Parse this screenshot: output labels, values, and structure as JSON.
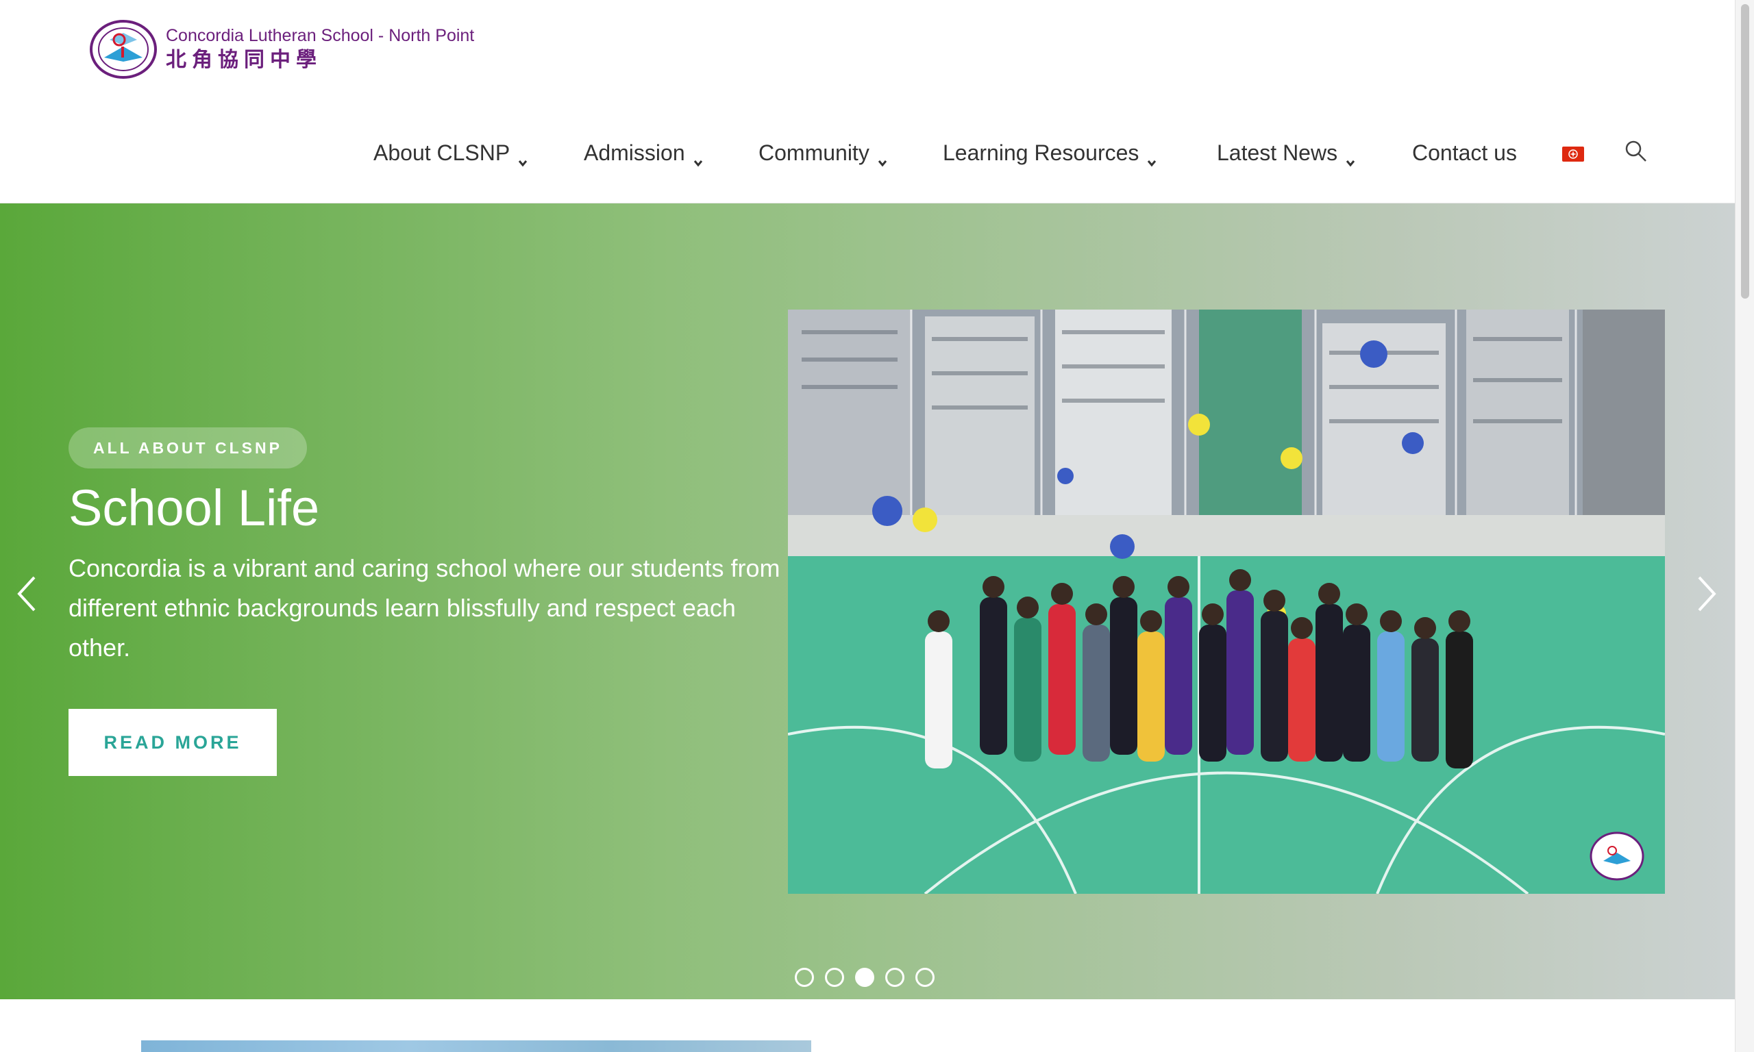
{
  "header": {
    "logo": {
      "name_en": "Concordia Lutheran School - North Point",
      "name_zh": "北角協同中學"
    },
    "nav": [
      {
        "label": "About CLSNP",
        "has_dropdown": true
      },
      {
        "label": "Admission",
        "has_dropdown": true
      },
      {
        "label": "Community",
        "has_dropdown": true
      },
      {
        "label": "Learning Resources",
        "has_dropdown": true
      },
      {
        "label": "Latest News",
        "has_dropdown": true
      },
      {
        "label": "Contact us",
        "has_dropdown": false
      }
    ],
    "language_icon": "hong-kong-flag-icon",
    "search_icon": "search-icon"
  },
  "hero": {
    "badge": "ALL ABOUT CLSNP",
    "title": "School Life",
    "description": "Concordia is a vibrant and caring school where our students from different ethnic backgrounds learn blissfully and respect each other.",
    "button_label": "READ MORE",
    "slides_total": 5,
    "active_slide": 3
  },
  "colors": {
    "brand_purple": "#6b1f7c",
    "hero_green": "#5aa83a",
    "button_text_teal": "#2aa597"
  }
}
